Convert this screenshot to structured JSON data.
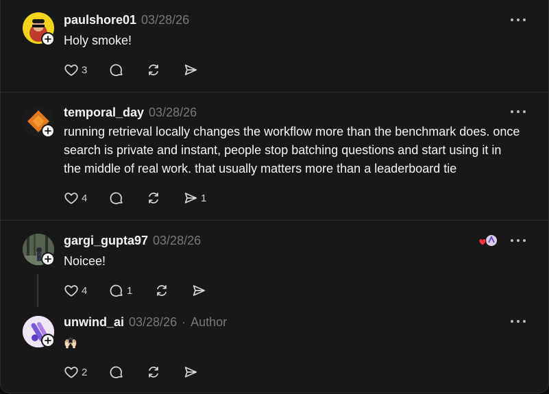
{
  "posts": [
    {
      "username": "paulshore01",
      "time": "03/28/26",
      "text": "Holy smoke!",
      "likes": "3",
      "replies": "",
      "reposts": "",
      "shares": ""
    },
    {
      "username": "temporal_day",
      "time": "03/28/26",
      "text": "running retrieval locally changes the workflow more than the benchmark does. once search is private and instant, people stop batching questions and start using it in the middle of real work. that usually matters more than a leaderboard tie",
      "likes": "4",
      "replies": "",
      "reposts": "",
      "shares": "1"
    },
    {
      "username": "gargi_gupta97",
      "time": "03/28/26",
      "text": "Noicee!",
      "likes": "4",
      "replies": "1",
      "reposts": "",
      "shares": ""
    },
    {
      "username": "unwind_ai",
      "time": "03/28/26",
      "author_separator": "·",
      "author_label": "Author",
      "text": "🙌🏻",
      "likes": "2",
      "replies": "",
      "reposts": "",
      "shares": ""
    }
  ],
  "icons": {
    "like": "heart-icon",
    "reply": "comment-icon",
    "repost": "repost-icon",
    "share": "send-icon",
    "more": "more-dots-icon",
    "follow": "plus-icon"
  },
  "colors": {
    "background": "#181818",
    "text": "#f3f5f7",
    "muted": "#777777",
    "divider": "#2e2e2e"
  }
}
